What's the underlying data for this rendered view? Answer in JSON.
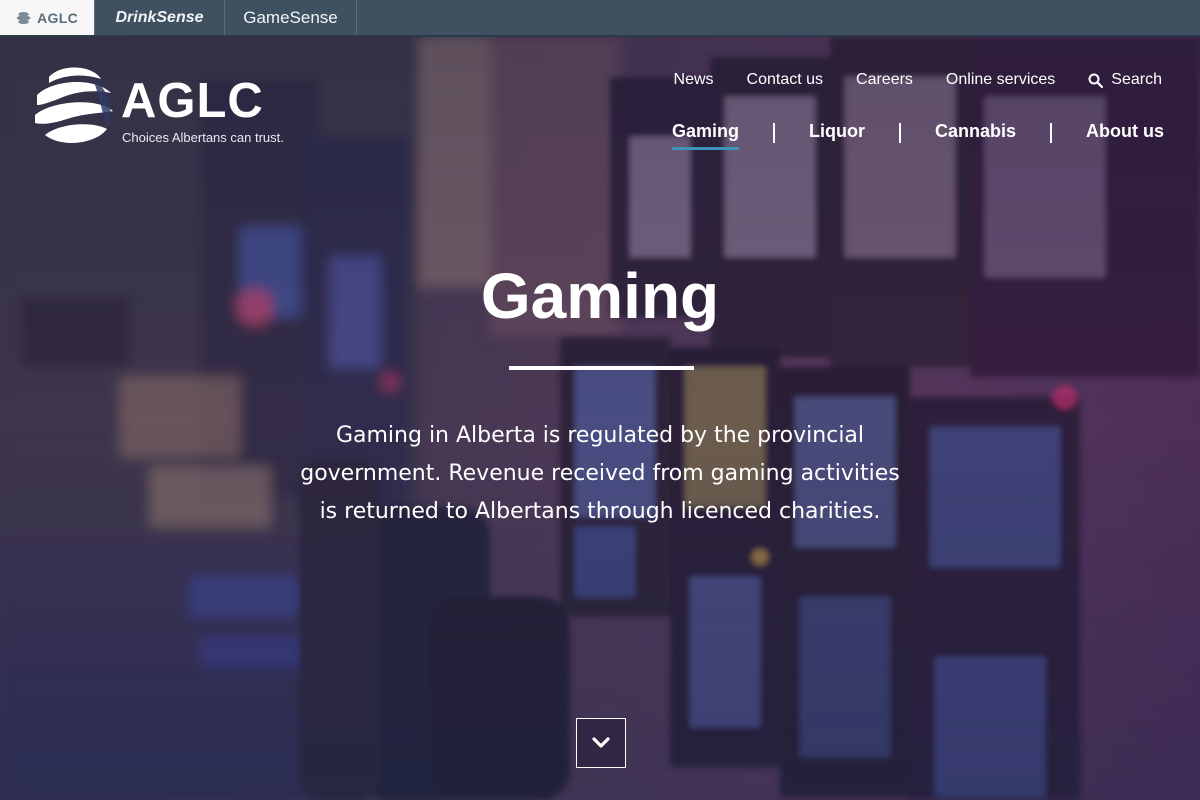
{
  "topbar": {
    "tabs": [
      {
        "label": "AGLC",
        "active": true
      },
      {
        "label": "DrinkSense",
        "active": false
      },
      {
        "label": "GameSense",
        "active": false
      }
    ]
  },
  "logo": {
    "wordmark": "AGLC",
    "tagline": "Choices Albertans can trust."
  },
  "utility_nav": {
    "items": [
      "News",
      "Contact us",
      "Careers",
      "Online services"
    ],
    "search_label": "Search",
    "search_icon": "search-icon"
  },
  "main_nav": {
    "items": [
      {
        "label": "Gaming",
        "current": true
      },
      {
        "label": "Liquor",
        "current": false
      },
      {
        "label": "Cannabis",
        "current": false
      },
      {
        "label": "About us",
        "current": false
      }
    ]
  },
  "hero": {
    "title": "Gaming",
    "lines": [
      "Gaming in Alberta is regulated by the provincial",
      "government. Revenue received from gaming activities",
      "is returned to Albertans through licenced charities."
    ],
    "scroll_icon": "chevron-down-icon"
  },
  "colors": {
    "topbar": "#3f5060",
    "active_underline": "#3d93b8",
    "hero_tint": "#5b3d5c"
  }
}
